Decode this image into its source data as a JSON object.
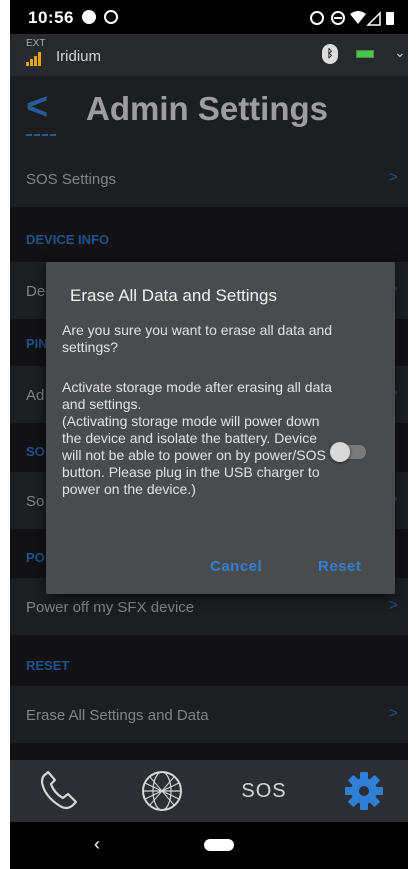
{
  "status_bar": {
    "time": "10:56",
    "right_icons": [
      "alarm-icon",
      "dnd-icon",
      "wifi-icon",
      "signal-icon",
      "battery-icon"
    ]
  },
  "device_bar": {
    "ext_label": "EXT",
    "network": "Iridium",
    "bluetooth_icon": "bluetooth-icon",
    "battery_icon": "battery-icon"
  },
  "header": {
    "title": "Admin Settings",
    "back_glyph": "<"
  },
  "list": {
    "sos_settings": "SOS Settings",
    "device_info_section": "DEVICE INFO",
    "device_row_partial": "De",
    "pin_section_partial": "PIN",
    "admin_row_partial": "Ad",
    "sos_section_partial": "SO",
    "sos_row_partial": "So",
    "power_section_partial": "PO",
    "power_off": "Power off my SFX device",
    "reset_section": "RESET",
    "erase_all": "Erase All Settings and Data",
    "arrow": ">"
  },
  "dialog": {
    "title": "Erase All Data and Settings",
    "question": "Are you sure you want to erase all data and settings?",
    "storage_text_1": "Activate storage mode after erasing all data and settings.",
    "storage_text_2": "(Activating storage mode will power down the device and isolate the battery. Device will not be able to power on by power/SOS button. Please plug in the USB charger to power on the device.)",
    "storage_toggle_on": false,
    "cancel_label": "Cancel",
    "reset_label": "Reset"
  },
  "tabbar": {
    "sos_label": "SOS",
    "tabs": [
      "phone-icon",
      "globe-icon",
      "sos",
      "gear-icon"
    ],
    "active_tab": "gear-icon"
  },
  "navbar": {
    "back_glyph": "‹"
  },
  "colors": {
    "accent": "#2f7fd6",
    "background": "#1c1d1f",
    "surface": "#2c2e33",
    "dialog": "#4a4b4d"
  }
}
